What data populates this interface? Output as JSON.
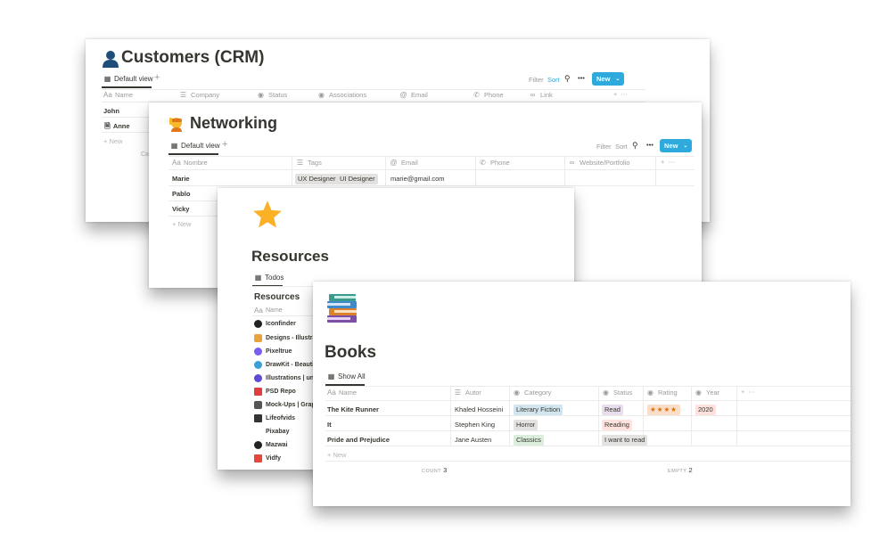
{
  "crm": {
    "title": "Customers (CRM)",
    "icon": "person-silhouette-icon",
    "view_tab": "Default view",
    "toolbar": {
      "filter": "Filter",
      "sort": "Sort",
      "new": "New"
    },
    "columns": [
      "Name",
      "Company",
      "Status",
      "Associations",
      "Email",
      "Phone",
      "Link"
    ],
    "rows": [
      "John",
      "Anne"
    ],
    "new_row": "+ New",
    "footer_fragment": "Ca"
  },
  "networking": {
    "title": "Networking",
    "icon": "person-raising-hand-icon",
    "view_tab": "Default view",
    "toolbar": {
      "filter": "Filter",
      "sort": "Sort",
      "new": "New"
    },
    "columns": [
      "Nombre",
      "Tags",
      "Email",
      "Phone",
      "Website/Portfolio"
    ],
    "rows": [
      {
        "name": "Marie",
        "tags": [
          "UX Designer",
          "UI Designer"
        ],
        "email": "marie@gmail.com"
      },
      {
        "name": "Pablo",
        "tags": [],
        "email": ""
      },
      {
        "name": "Vicky",
        "tags": [],
        "email": ""
      }
    ],
    "new_row": "+ New"
  },
  "resources": {
    "title": "Resources",
    "icon": "star-icon",
    "view_tab": "Todos",
    "subtitle": "Resources",
    "column": "Name",
    "items": [
      {
        "label": "Iconfinder",
        "color": "#222222"
      },
      {
        "label": "Designs - Illustrack",
        "color": "#e8a33b"
      },
      {
        "label": "Pixeltrue",
        "color": "#7b5cf0"
      },
      {
        "label": "DrawKit - Beautifu",
        "color": "#3aa0d8"
      },
      {
        "label": "Illustrations | unDr",
        "color": "#5b4bd6"
      },
      {
        "label": "PSD Repo",
        "color": "#e03e3e"
      },
      {
        "label": "Mock-Ups | Graph",
        "color": "#555555"
      },
      {
        "label": "Lifeofvids",
        "color": "#333333"
      },
      {
        "label": "Pixabay",
        "color": "#ffffff"
      },
      {
        "label": "Mazwai",
        "color": "#222222"
      },
      {
        "label": "Vidfy",
        "color": "#e8453c"
      }
    ]
  },
  "books": {
    "title": "Books",
    "icon": "books-icon",
    "view_tab": "Show All",
    "columns": [
      "Name",
      "Autor",
      "Category",
      "Status",
      "Rating",
      "Year"
    ],
    "rows": [
      {
        "name": "The Kite Runner",
        "author": "Khaled Hosseini",
        "category": "Literary Fiction",
        "status": "Read",
        "rating": "★★★★",
        "year": "2020"
      },
      {
        "name": "It",
        "author": "Stephen King",
        "category": "Horror",
        "status": "Reading",
        "rating": "",
        "year": ""
      },
      {
        "name": "Pride and Prejudice",
        "author": "Jane Austen",
        "category": "Classics",
        "status": "I want to read",
        "rating": "",
        "year": ""
      }
    ],
    "new_row": "+ New",
    "footer": {
      "count_label": "COUNT",
      "count_value": "3",
      "empty_label": "EMPTY",
      "empty_value": "2"
    }
  },
  "colors": {
    "accent_blue": "#2eaadc",
    "tag_blue": "#d3e5ef",
    "tag_purple": "#e8deee",
    "tag_red": "#ffe2dd",
    "tag_orange": "#fadec9",
    "tag_green": "#dbeddb",
    "tag_gray": "#e3e2e0",
    "tag_yellow": "#fdecc8"
  }
}
